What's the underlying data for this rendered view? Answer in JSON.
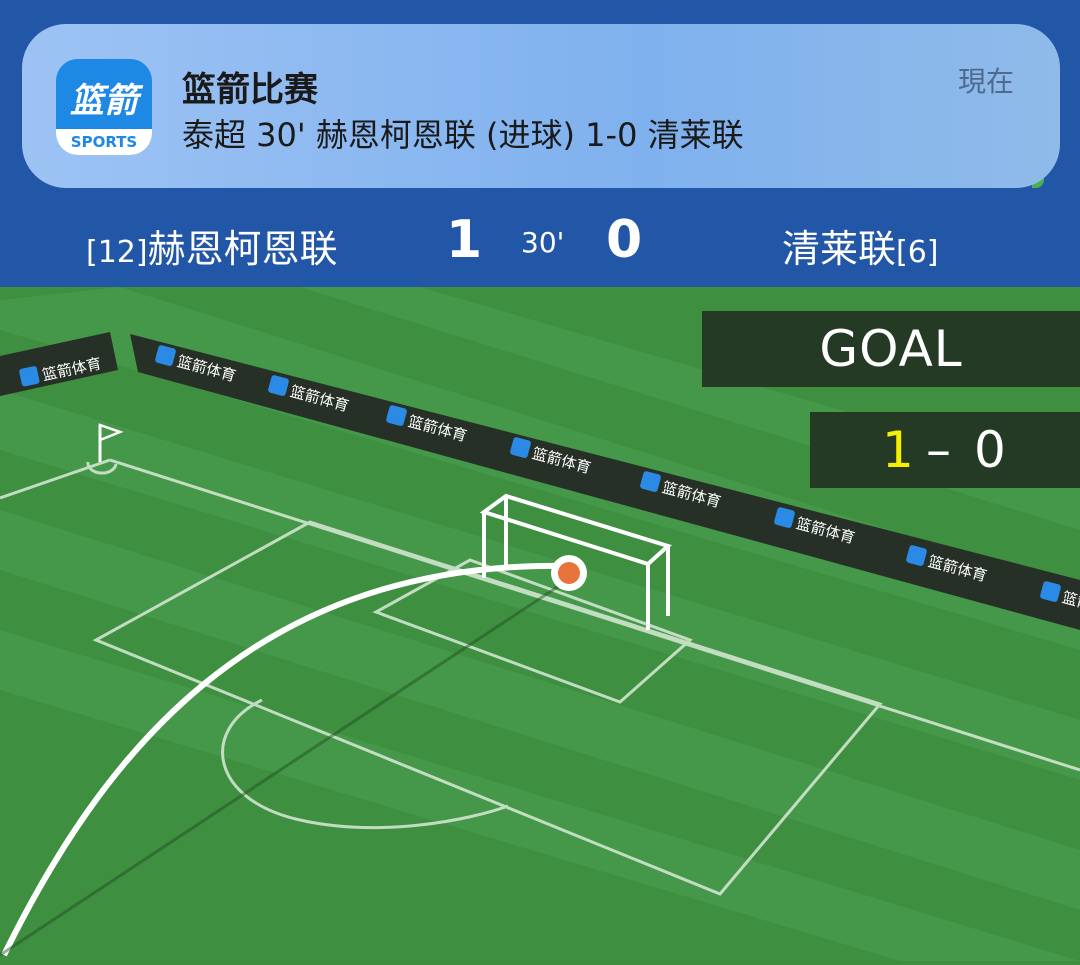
{
  "notification": {
    "app_name": "篮箭比赛",
    "message": "泰超 30' 赫恩柯恩联 (进球) 1-0 清莱联",
    "time": "現在",
    "app_icon": {
      "text": "篮箭",
      "label": "SPORTS"
    }
  },
  "scoreboard": {
    "home_rank": "[12]",
    "home_team": "赫恩柯恩联",
    "home_score": "1",
    "minute": "30'",
    "away_score": "0",
    "away_team": "清莱联",
    "away_rank": "[6]"
  },
  "pitch": {
    "goal_banner": "GOAL",
    "score": {
      "home": "1",
      "dash": "–",
      "away": "0"
    },
    "ad_text": "篮箭体育",
    "ad_logo_text": "篮箭"
  },
  "colors": {
    "header_blue": "#2256a6",
    "pitch_green": "#3d8f3f",
    "ball_orange": "#e8743b",
    "score_highlight": "#f4f000"
  }
}
